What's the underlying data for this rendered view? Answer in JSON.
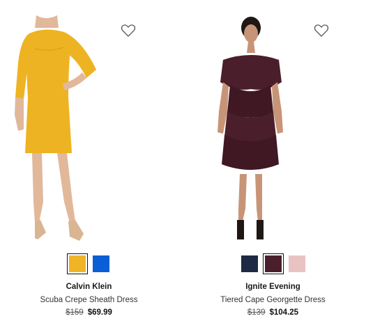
{
  "products": [
    {
      "brand": "Calvin Klein",
      "name": "Scuba Crepe Sheath Dress",
      "original_price": "$159",
      "sale_price": "$69.99",
      "favorite_icon": "heart-outline-icon",
      "swatches": [
        {
          "color": "#f0b429",
          "selected": true
        },
        {
          "color": "#0a5fd6",
          "selected": false
        }
      ]
    },
    {
      "brand": "Ignite Evening",
      "name": "Tiered Cape Georgette Dress",
      "original_price": "$139",
      "sale_price": "$104.25",
      "favorite_icon": "heart-outline-icon",
      "swatches": [
        {
          "color": "#1e2a44",
          "selected": false
        },
        {
          "color": "#4b1e2c",
          "selected": true
        },
        {
          "color": "#e9c3c2",
          "selected": false
        }
      ]
    }
  ],
  "colors": {
    "dress_yellow": "#eeb323",
    "dress_burgundy": "#4a1e2a",
    "skin": "#e2b89a",
    "shoe_nude": "#d9b592",
    "hair_dark": "#1e1714"
  }
}
